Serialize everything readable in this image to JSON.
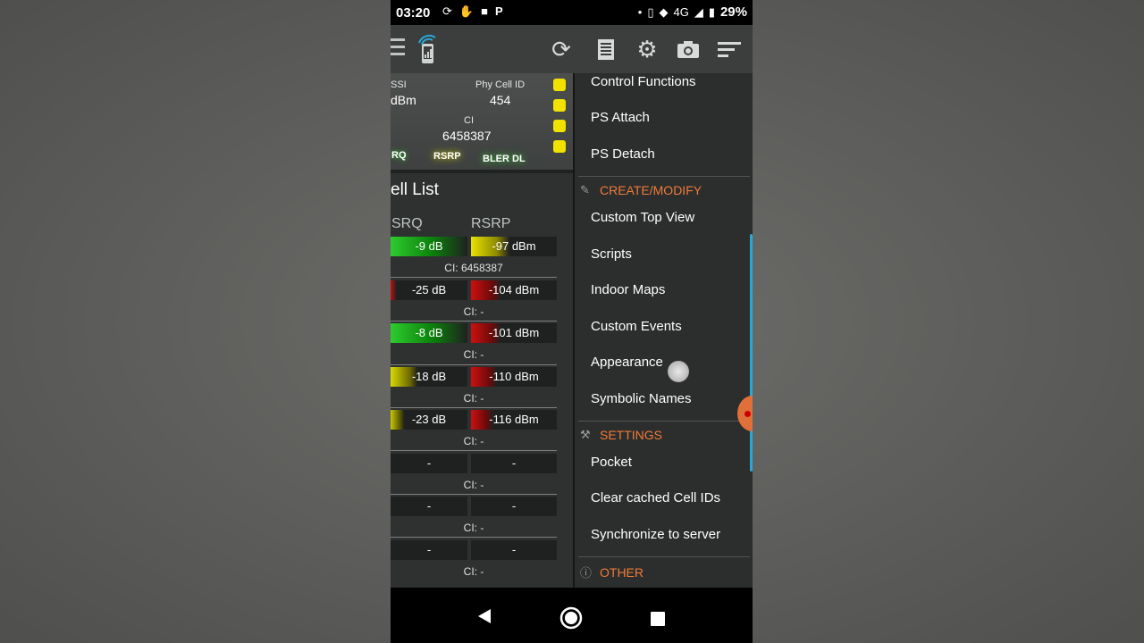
{
  "status_bar": {
    "time": "03:20",
    "network": "4G",
    "battery": "29%"
  },
  "gauge": {
    "rssi_label": "SSI",
    "rssi_value": "dBm",
    "pci_label": "Phy Cell ID",
    "pci_value": "454",
    "ci_label": "CI",
    "ci_value": "6458387",
    "tab_rsrq": "RQ",
    "tab_rsrp": "RSRP",
    "tab_bler": "BLER DL"
  },
  "cell_list": {
    "title": "ell List",
    "col_rsrq": "SRQ",
    "col_rsrp": "RSRP",
    "rows": [
      {
        "rsrq": "-9 dB",
        "rsrp": "-97 dBm",
        "ci": "CI: 6458387"
      },
      {
        "rsrq": "-25 dB",
        "rsrp": "-104 dBm",
        "ci": "CI: -"
      },
      {
        "rsrq": "-8 dB",
        "rsrp": "-101 dBm",
        "ci": "CI: -"
      },
      {
        "rsrq": "-18 dB",
        "rsrp": "-110 dBm",
        "ci": "CI: -"
      },
      {
        "rsrq": "-23 dB",
        "rsrp": "-116 dBm",
        "ci": "CI: -"
      },
      {
        "rsrq": "-",
        "rsrp": "-",
        "ci": "CI: -"
      },
      {
        "rsrq": "-",
        "rsrp": "-",
        "ci": "CI: -"
      },
      {
        "rsrq": "-",
        "rsrp": "-",
        "ci": "CI: -"
      }
    ]
  },
  "drawer": {
    "items_top": [
      "Control Functions",
      "PS Attach",
      "PS Detach"
    ],
    "section_create": "CREATE/MODIFY",
    "items_create": [
      "Custom Top View",
      "Scripts",
      "Indoor Maps",
      "Custom Events",
      "Appearance",
      "Symbolic Names"
    ],
    "section_settings": "SETTINGS",
    "items_settings": [
      "Pocket",
      "Clear cached Cell IDs",
      "Synchronize to server"
    ],
    "section_other": "OTHER"
  },
  "colors": {
    "accent_orange": "#f07a3a",
    "good_green": "#22c322",
    "mid_yellow": "#d8d800",
    "bad_red": "#cc1010",
    "scroll_blue": "#2aa7d8"
  },
  "icons": [
    "menu-icon",
    "signal-phone-icon",
    "refresh-icon",
    "log-icon",
    "settings-icon",
    "camera-icon",
    "sort-icon",
    "back-icon",
    "home-icon",
    "recents-icon"
  ]
}
